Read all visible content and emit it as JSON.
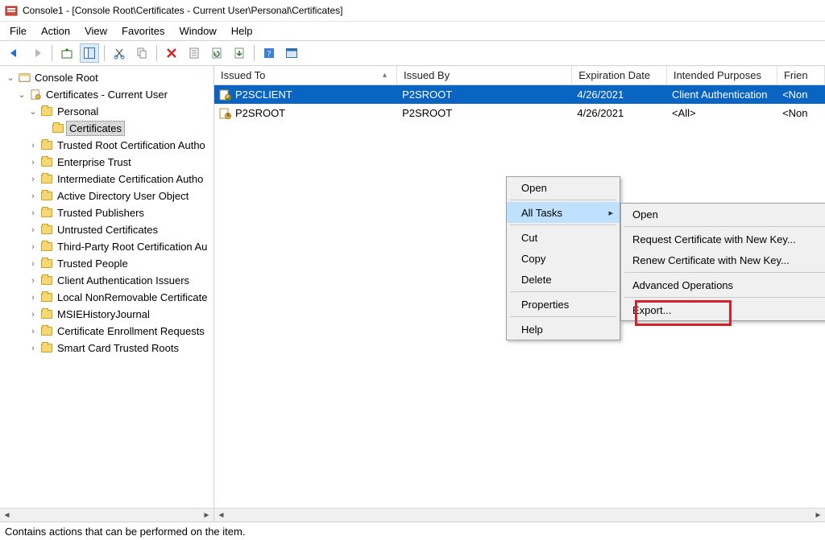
{
  "window": {
    "title": "Console1 - [Console Root\\Certificates - Current User\\Personal\\Certificates]"
  },
  "menu": {
    "file": "File",
    "action": "Action",
    "view": "View",
    "favorites": "Favorites",
    "window": "Window",
    "help": "Help"
  },
  "tree": {
    "root": "Console Root",
    "certs": "Certificates - Current User",
    "personal": "Personal",
    "certificates": "Certificates",
    "items": [
      "Trusted Root Certification Autho",
      "Enterprise Trust",
      "Intermediate Certification Autho",
      "Active Directory User Object",
      "Trusted Publishers",
      "Untrusted Certificates",
      "Third-Party Root Certification Au",
      "Trusted People",
      "Client Authentication Issuers",
      "Local NonRemovable Certificate",
      "MSIEHistoryJournal",
      "Certificate Enrollment Requests",
      "Smart Card Trusted Roots"
    ]
  },
  "grid": {
    "headers": [
      "Issued To",
      "Issued By",
      "Expiration Date",
      "Intended Purposes",
      "Frien"
    ],
    "rows": [
      {
        "issued_to": "P2SCLIENT",
        "issued_by": "P2SROOT",
        "exp": "4/26/2021",
        "purpose": "Client Authentication",
        "friendly": "<Non",
        "selected": true,
        "iconType": "client"
      },
      {
        "issued_to": "P2SROOT",
        "issued_by": "P2SROOT",
        "exp": "4/26/2021",
        "purpose": "<All>",
        "friendly": "<Non",
        "selected": false,
        "iconType": "root"
      }
    ]
  },
  "ctx1": {
    "open": "Open",
    "alltasks": "All Tasks",
    "cut": "Cut",
    "copy": "Copy",
    "delete": "Delete",
    "properties": "Properties",
    "help": "Help"
  },
  "ctx2": {
    "open": "Open",
    "request": "Request Certificate with New Key...",
    "renew": "Renew Certificate with New Key...",
    "advanced": "Advanced Operations",
    "export": "Export..."
  },
  "status": "Contains actions that can be performed on the item."
}
